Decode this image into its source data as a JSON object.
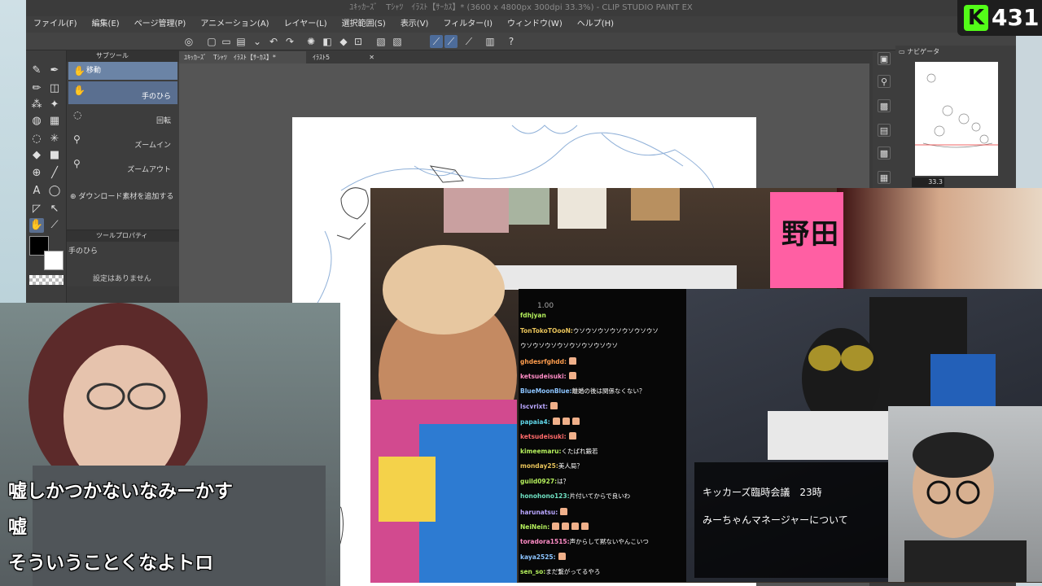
{
  "window": {
    "title": "ﾕｷｯｶｰｽﾞ　Tｼｬﾂ　ｲﾗｽﾄ【ｻｰｶｽ】* (3600 x 4800px 300dpi 33.3%)  - CLIP STUDIO PAINT EX"
  },
  "menu": [
    "ファイル(F)",
    "編集(E)",
    "ページ管理(P)",
    "アニメーション(A)",
    "レイヤー(L)",
    "選択範囲(S)",
    "表示(V)",
    "フィルター(I)",
    "ウィンドウ(W)",
    "ヘルプ(H)"
  ],
  "subtool": {
    "panel_label": "サブツール",
    "items": [
      "移動",
      "手のひら",
      "回転",
      "ズームイン",
      "ズームアウト"
    ],
    "add_material": "ダウンロード素材を追加する"
  },
  "tool_property": {
    "panel_label": "ツールプロパティ",
    "tool_name": "手のひら",
    "empty_message": "設定はありません"
  },
  "doc_tabs": [
    "ﾕｷｯｶｰｽﾞ　Tｼｬﾂ　ｲﾗｽﾄ【ｻｰｶｽ】*",
    "ｲﾗｽﾄ5"
  ],
  "navigator": {
    "panel_label": "ナビゲータ",
    "zoom": "33.3"
  },
  "chat": {
    "top_value": "1.00",
    "messages": [
      {
        "user": "fdhjyan",
        "text": "",
        "hands": 0,
        "color": "lime"
      },
      {
        "user": "TonTokoTOooN:",
        "text": "ウソウソウソウソウソウソウソ",
        "hands": 0,
        "color": "gold"
      },
      {
        "user": "",
        "text": "ウソウソウソウソウソウソウソウソ",
        "hands": 0,
        "color": "gold"
      },
      {
        "user": "ghdesrfghdd:",
        "text": "",
        "hands": 1,
        "color": "org"
      },
      {
        "user": "ketsudeisuki:",
        "text": "",
        "hands": 1,
        "color": "pink"
      },
      {
        "user": "BlueMoonBlue:",
        "text": "離婚の後は関係なくない？",
        "hands": 0,
        "color": "blue"
      },
      {
        "user": "lscvrixt:",
        "text": "",
        "hands": 1,
        "color": "lav"
      },
      {
        "user": "papaia4:",
        "text": "",
        "hands": 3,
        "color": "cyan"
      },
      {
        "user": "ketsudeisuki:",
        "text": "",
        "hands": 1,
        "color": "red"
      },
      {
        "user": "kimeemaru:",
        "text": "くたばれ鍛若",
        "hands": 0,
        "color": "lime"
      },
      {
        "user": "monday25:",
        "text": "美人局？",
        "hands": 0,
        "color": "gold"
      },
      {
        "user": "guild0927:",
        "text": "は？",
        "hands": 0,
        "color": "lime"
      },
      {
        "user": "honohono123:",
        "text": "片付いてからで良いわ",
        "hands": 0,
        "color": "mint"
      },
      {
        "user": "harunatsu:",
        "text": "",
        "hands": 1,
        "color": "lav"
      },
      {
        "user": "NeiNein:",
        "text": "",
        "hands": 4,
        "color": "lime"
      },
      {
        "user": "toradora1515:",
        "text": "声からして黙ないやんこいつ",
        "hands": 0,
        "color": "pink"
      },
      {
        "user": "kaya2525:",
        "text": "",
        "hands": 1,
        "color": "blue"
      },
      {
        "user": "sen_so:",
        "text": "まだ繋がってるやろ",
        "hands": 0,
        "color": "lime"
      }
    ]
  },
  "meeting": {
    "line1": "キッカーズ臨時会議　23時",
    "line2": "みーちゃんマネージャーについて"
  },
  "banner_text": "野田",
  "subtitles": [
    "嘘しかつかないなみーかす",
    "嘘",
    "そういうことくなよトロ"
  ],
  "viewer_badge": {
    "logo": "K",
    "count": "431",
    "accent": "#53fc18"
  }
}
